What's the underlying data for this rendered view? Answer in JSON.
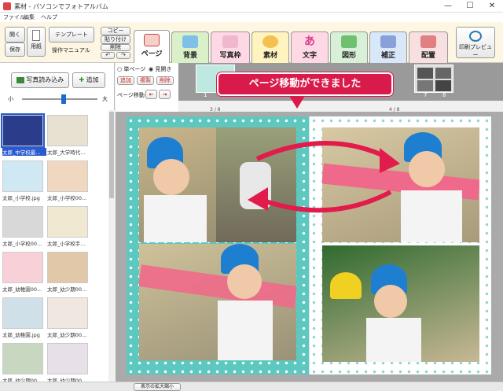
{
  "window": {
    "title": "素材 - パソコンでフォトアルバム",
    "minimize": "—",
    "maximize": "☐",
    "close": "✕"
  },
  "menu": [
    "ファイル",
    "編集",
    "ヘルプ"
  ],
  "toolbar": {
    "open": "開く",
    "save": "保存",
    "paper": "用紙",
    "template": "テンプレート",
    "manual": "操作マニュアル",
    "copy": "コピー",
    "paste": "貼り付け",
    "delete": "削除",
    "print_preview": "印刷プレビュー"
  },
  "tabs": [
    {
      "label": "ページ",
      "color": "#ffffff",
      "icon_color": "#e74c3c"
    },
    {
      "label": "背景",
      "color": "#d9f0c8",
      "icon_color": "#3a9ad9"
    },
    {
      "label": "写真枠",
      "color": "#ffd8e6",
      "icon_color": "#d98cb0"
    },
    {
      "label": "素材",
      "color": "#fff3c0",
      "icon_color": "#e8a030"
    },
    {
      "label": "文字",
      "color": "#ffd8e6",
      "icon_color": "#d94090"
    },
    {
      "label": "図形",
      "color": "#d8f0d8",
      "icon_color": "#60b060"
    },
    {
      "label": "補正",
      "color": "#d8e8f8",
      "icon_color": "#6080c0"
    },
    {
      "label": "配置",
      "color": "#f8e0e0",
      "icon_color": "#c04040"
    }
  ],
  "left": {
    "load_photos": "写真読み込み",
    "add": "追加",
    "size_small": "小",
    "size_large": "大",
    "thumb_size_level": 0.55,
    "thumbnails": [
      "太郎_中学校最...",
      "太郎_大学時代...",
      "太郎_小学校.jpg",
      "太郎_小学校00...",
      "太郎_小学校00...",
      "太郎_小学校手...",
      "太郎_幼稚園00...",
      "太郎_幼少期00...",
      "太郎_幼稚園.jpg",
      "太郎_幼少期00...",
      "太郎_幼少期00...",
      "太郎_幼少期00..."
    ]
  },
  "options": {
    "single_page": "単ページ",
    "spread": "見開き",
    "add": "追加",
    "duplicate": "複製",
    "delete": "削除",
    "page_move": "ページ移動"
  },
  "pages": {
    "strip_labels": [
      "1",
      "7",
      "8"
    ],
    "left_page": "3 / 8",
    "right_page": "4 / 8"
  },
  "callout": {
    "text": "ページ移動ができました"
  },
  "status": {
    "zoom_display": "表示の拡大縮小"
  }
}
